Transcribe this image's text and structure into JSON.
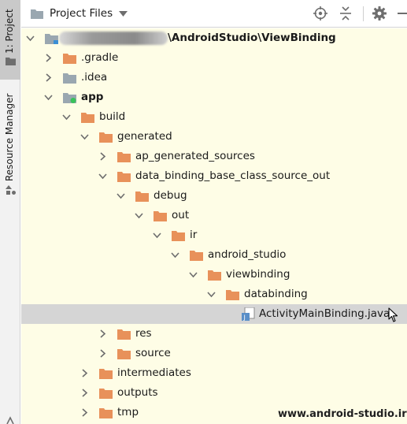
{
  "side_strip": {
    "project_tab": "1: Project",
    "resource_tab": "Resource Manager"
  },
  "header": {
    "title": "Project Files"
  },
  "tree": {
    "root_suffix": "\\AndroidStudio\\ViewBinding",
    "items": [
      {
        "label": ".gradle"
      },
      {
        "label": ".idea"
      },
      {
        "label": "app"
      },
      {
        "label": "build"
      },
      {
        "label": "generated"
      },
      {
        "label": "ap_generated_sources"
      },
      {
        "label": "data_binding_base_class_source_out"
      },
      {
        "label": "debug"
      },
      {
        "label": "out"
      },
      {
        "label": "ir"
      },
      {
        "label": "android_studio"
      },
      {
        "label": "viewbinding"
      },
      {
        "label": "databinding"
      },
      {
        "label": "ActivityMainBinding.java"
      },
      {
        "label": "res"
      },
      {
        "label": "source"
      },
      {
        "label": "intermediates"
      },
      {
        "label": "outputs"
      },
      {
        "label": "tmp"
      }
    ]
  },
  "watermark": "www.android-studio.ir",
  "colors": {
    "tree_background": "#fefde6",
    "folder_orange": "#e8915a",
    "folder_gray": "#9aa7b0",
    "selection": "#d5d5d5",
    "module_badge": "#39c25a",
    "java_file_blue": "#5a8fc8"
  },
  "icons": [
    "folder-icon",
    "chevron-down-icon",
    "chevron-right-icon",
    "locate-icon",
    "collapse-icon",
    "gear-icon",
    "minimize-icon",
    "java-file-icon",
    "mouse-cursor-icon",
    "resource-manager-icon"
  ]
}
